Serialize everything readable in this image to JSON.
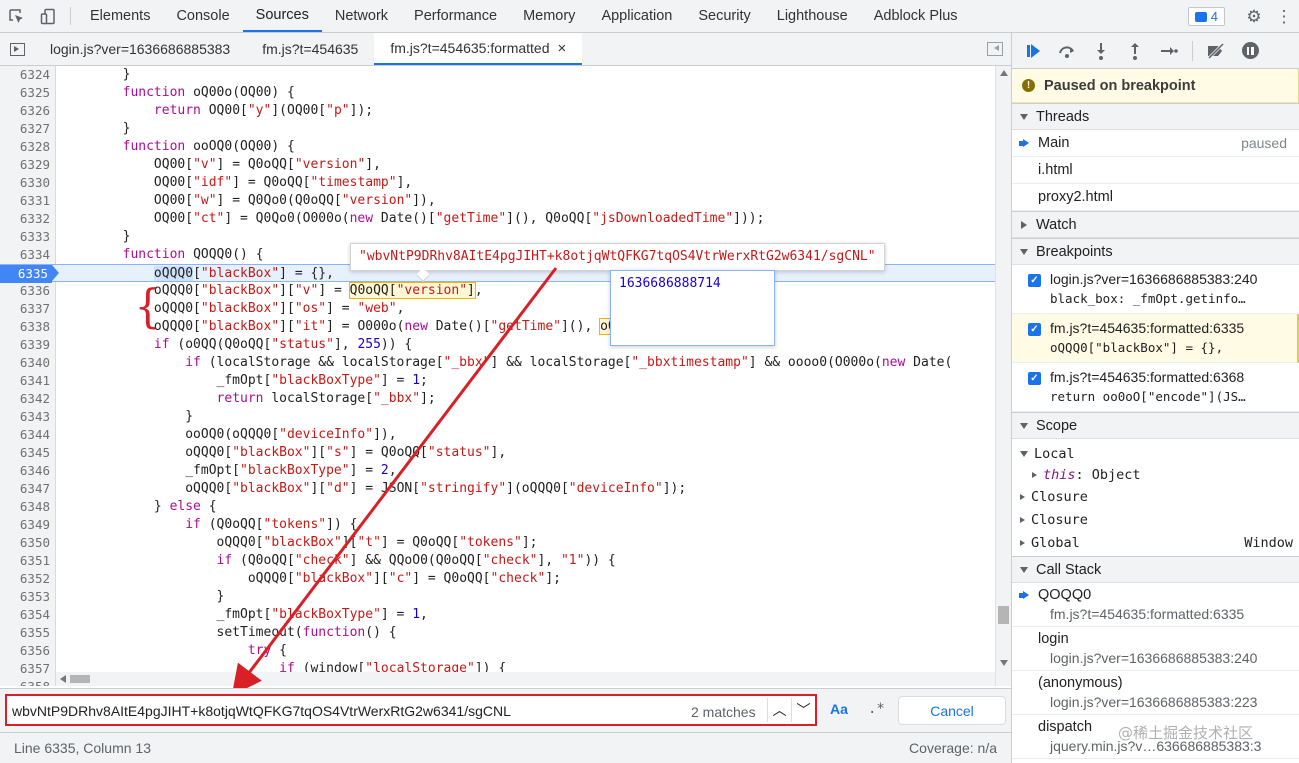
{
  "toolbar": {
    "tabs": [
      "Elements",
      "Console",
      "Sources",
      "Network",
      "Performance",
      "Memory",
      "Application",
      "Security",
      "Lighthouse",
      "Adblock Plus"
    ],
    "active_tab": "Sources",
    "message_count": "4"
  },
  "files": {
    "tabs": [
      "login.js?ver=1636686885383",
      "fm.js?t=454635",
      "fm.js?t=454635:formatted"
    ],
    "active": "fm.js?t=454635:formatted",
    "close_glyph": "×"
  },
  "editor": {
    "current_line": "6335",
    "lines": [
      {
        "n": "6324",
        "html": "        }"
      },
      {
        "n": "6325",
        "html": "        <span class=\"kw\">function</span> oQ00o(OQ00) {"
      },
      {
        "n": "6326",
        "html": "            <span class=\"kw\">return</span> OQ00[<span class=\"str\">\"y\"</span>](OQ00[<span class=\"str\">\"p\"</span>]);"
      },
      {
        "n": "6327",
        "html": "        }"
      },
      {
        "n": "6328",
        "html": "        <span class=\"kw\">function</span> ooOQ0(OQ00) {"
      },
      {
        "n": "6329",
        "html": "            OQ00[<span class=\"str\">\"v\"</span>] = Q0oQQ[<span class=\"str\">\"version\"</span>],"
      },
      {
        "n": "6330",
        "html": "            OQ00[<span class=\"str\">\"idf\"</span>] = Q0oQQ[<span class=\"str\">\"timestamp\"</span>],"
      },
      {
        "n": "6331",
        "html": "            OQ00[<span class=\"str\">\"w\"</span>] = Q0Qo0(Q0oQQ[<span class=\"str\">\"version\"</span>]),"
      },
      {
        "n": "6332",
        "html": "            OQ00[<span class=\"str\">\"ct\"</span>] = Q0Qo0(O000o(<span class=\"kw\">new</span> Date()[<span class=\"str\">\"getTime\"</span>](), Q0oQQ[<span class=\"str\">\"jsDownloadedTime\"</span>]));"
      },
      {
        "n": "6333",
        "html": "        }"
      },
      {
        "n": "6334",
        "html": "        <span class=\"kw\">function</span> QOQQ0() {"
      },
      {
        "n": "6335",
        "html": "            <span class=\"hl\">oQQQ0</span>[<span class=\"str\">\"blackBox\"</span>] = {},"
      },
      {
        "n": "6336",
        "html": "            oQQQ0[<span class=\"str\">\"blackBox\"</span>][<span class=\"str\">\"v\"</span>] = <span class=\"boxed\">Q0oQQ[<span class=\"str\">\"version\"</span>]</span>,"
      },
      {
        "n": "6337",
        "html": "            oQQQ0[<span class=\"str\">\"blackBox\"</span>][<span class=\"str\">\"os\"</span>] = <span class=\"str\">\"web\"</span>,"
      },
      {
        "n": "6338",
        "html": "            oQQQ0[<span class=\"str\">\"blackBox\"</span>][<span class=\"str\">\"it\"</span>] = O000o(<span class=\"kw\">new</span> Date()[<span class=\"str\">\"getTime\"</span>](), <span class=\"boxed\">oQ0Qo</span>);"
      },
      {
        "n": "6339",
        "html": "            <span class=\"kw\">if</span> (o0QQ(Q0oQQ[<span class=\"str\">\"status\"</span>], <span class=\"num\">255</span>)) {"
      },
      {
        "n": "6340",
        "html": "                <span class=\"kw\">if</span> (localStorage &amp;&amp; localStorage[<span class=\"str\">\"_bbx\"</span>] &amp;&amp; localStorage[<span class=\"str\">\"_bbxtimestamp\"</span>] &amp;&amp; oooo0(O000o(<span class=\"kw\">new</span> Date("
      },
      {
        "n": "6341",
        "html": "                    _fmOpt[<span class=\"str\">\"blackBoxType\"</span>] = <span class=\"num\">1</span>;"
      },
      {
        "n": "6342",
        "html": "                    <span class=\"kw\">return</span> localStorage[<span class=\"str\">\"_bbx\"</span>];"
      },
      {
        "n": "6343",
        "html": "                }"
      },
      {
        "n": "6344",
        "html": "                ooOQ0(oQQQ0[<span class=\"str\">\"deviceInfo\"</span>]),"
      },
      {
        "n": "6345",
        "html": "                oQQQ0[<span class=\"str\">\"blackBox\"</span>][<span class=\"str\">\"s\"</span>] = Q0oQQ[<span class=\"str\">\"status\"</span>],"
      },
      {
        "n": "6346",
        "html": "                _fmOpt[<span class=\"str\">\"blackBoxType\"</span>] = <span class=\"num\">2</span>,"
      },
      {
        "n": "6347",
        "html": "                oQQQ0[<span class=\"str\">\"blackBox\"</span>][<span class=\"str\">\"d\"</span>] = JSON[<span class=\"str\">\"stringify\"</span>](oQQQ0[<span class=\"str\">\"deviceInfo\"</span>]);"
      },
      {
        "n": "6348",
        "html": "            } <span class=\"kw\">else</span> {"
      },
      {
        "n": "6349",
        "html": "                <span class=\"kw\">if</span> (Q0oQQ[<span class=\"str\">\"tokens\"</span>]) {"
      },
      {
        "n": "6350",
        "html": "                    oQQQ0[<span class=\"str\">\"blackBox\"</span>][<span class=\"str\">\"t\"</span>] = Q0oQQ[<span class=\"str\">\"tokens\"</span>];"
      },
      {
        "n": "6351",
        "html": "                    <span class=\"kw\">if</span> (Q0oQQ[<span class=\"str\">\"check\"</span>] &amp;&amp; QQoO0(Q0oQQ[<span class=\"str\">\"check\"</span>], <span class=\"str\">\"1\"</span>)) {"
      },
      {
        "n": "6352",
        "html": "                        oQQQ0[<span class=\"str\">\"blackBox\"</span>][<span class=\"str\">\"c\"</span>] = Q0oQQ[<span class=\"str\">\"check\"</span>];"
      },
      {
        "n": "6353",
        "html": "                    }"
      },
      {
        "n": "6354",
        "html": "                    _fmOpt[<span class=\"str\">\"blackBoxType\"</span>] = <span class=\"num\">1</span>,"
      },
      {
        "n": "6355",
        "html": "                    setTimeout(<span class=\"kw\">function</span>() {"
      },
      {
        "n": "6356",
        "html": "                        <span class=\"kw\">try</span> {"
      },
      {
        "n": "6357",
        "html": "                            <span class=\"kw\">if</span> (window[<span class=\"str\">\"localStorage\"</span>]) {"
      },
      {
        "n": "6358",
        "html": ""
      }
    ]
  },
  "popovers": {
    "blackbox_value": "\"wbvNtP9DRhv8AItE4pgJIHT+k8otjqWtQFKG7tqOS4VtrWerxRtG2w6341/sgCNL\"",
    "number_value": "1636686888714"
  },
  "search": {
    "value": "wbvNtP9DRhv8AItE4pgJIHT+k8otjqWtQFKG7tqOS4VtrWerxRtG2w6341/sgCNL",
    "match_count": "2 matches",
    "case_label": "Aa",
    "regex_label": ".*",
    "cancel_label": "Cancel"
  },
  "status": {
    "position": "Line 6335, Column 13",
    "coverage": "Coverage: n/a"
  },
  "debugger": {
    "paused_label": "Paused on breakpoint",
    "threads_title": "Threads",
    "threads": [
      {
        "name": "Main",
        "status": "paused"
      },
      {
        "name": "i.html",
        "status": ""
      },
      {
        "name": "proxy2.html",
        "status": ""
      }
    ],
    "watch_title": "Watch",
    "breakpoints_title": "Breakpoints",
    "breakpoints": [
      {
        "loc": "login.js?ver=1636686885383:240",
        "snippet": "black_box: _fmOpt.getinfo…"
      },
      {
        "loc": "fm.js?t=454635:formatted:6335",
        "snippet": "oQQQ0[\"blackBox\"] = {},"
      },
      {
        "loc": "fm.js?t=454635:formatted:6368",
        "snippet": "return oo0oO[\"encode\"](JS…"
      }
    ],
    "scope_title": "Scope",
    "scope": {
      "local": "Local",
      "this_key": "this",
      "this_val": ": Object",
      "closure1": "Closure",
      "closure2": "Closure",
      "global": "Global",
      "global_val": "Window"
    },
    "callstack_title": "Call Stack",
    "frames": [
      {
        "name": "QOQQ0",
        "loc": "fm.js?t=454635:formatted:6335"
      },
      {
        "name": "login",
        "loc": "login.js?ver=1636686885383:240"
      },
      {
        "name": "(anonymous)",
        "loc": "login.js?ver=1636686885383:223"
      },
      {
        "name": "dispatch",
        "loc": "jquery.min.js?v…636686885383:3"
      }
    ]
  },
  "watermark": "@稀土掘金技术社区",
  "colors": {
    "accent": "#1a73e8",
    "annotation": "#d92027",
    "paused_bg": "#fffbe5"
  }
}
